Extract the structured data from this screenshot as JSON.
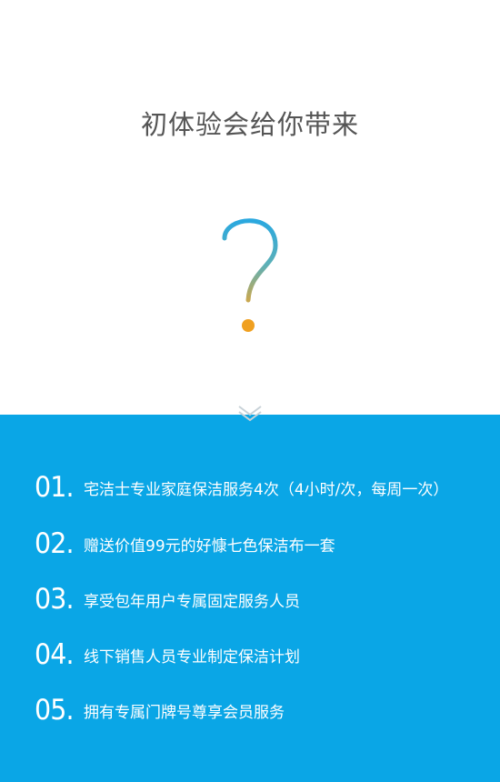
{
  "header": {
    "title": "初体验会给你带来"
  },
  "colors": {
    "accent_blue": "#0aa6e6",
    "question_dot": "#f0a020"
  },
  "icons": {
    "question": "question-mark-icon",
    "chevron": "double-chevron-down-icon"
  },
  "benefits": [
    {
      "num": "01.",
      "text": "宅洁士专业家庭保洁服务4次（4小时/次，每周一次）"
    },
    {
      "num": "02.",
      "text": "赠送价值99元的好慷七色保洁布一套"
    },
    {
      "num": "03.",
      "text": "享受包年用户专属固定服务人员"
    },
    {
      "num": "04.",
      "text": "线下销售人员专业制定保洁计划"
    },
    {
      "num": "05.",
      "text": "拥有专属门牌号尊享会员服务"
    }
  ]
}
